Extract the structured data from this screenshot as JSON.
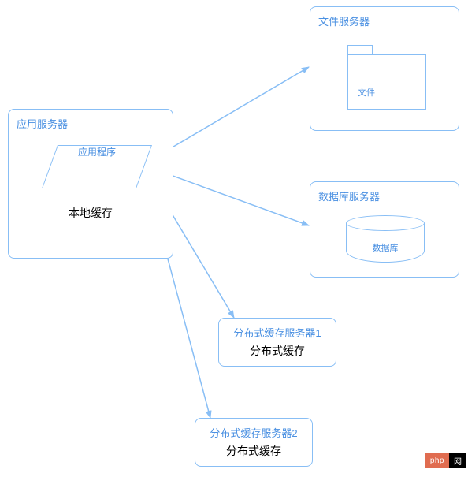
{
  "app_server": {
    "title": "应用服务器",
    "program_label": "应用程序",
    "subtitle": "本地缓存"
  },
  "file_server": {
    "title": "文件服务器",
    "folder_label": "文件"
  },
  "db_server": {
    "title": "数据库服务器",
    "db_label": "数据库"
  },
  "cache_server_1": {
    "title": "分布式缓存服务器1",
    "subtitle": "分布式缓存"
  },
  "cache_server_2": {
    "title": "分布式缓存服务器2",
    "subtitle": "分布式缓存"
  },
  "badge": {
    "left": "php",
    "right": "网"
  },
  "colors": {
    "stroke": "#88bef5",
    "text_blue": "#4a90e2"
  }
}
